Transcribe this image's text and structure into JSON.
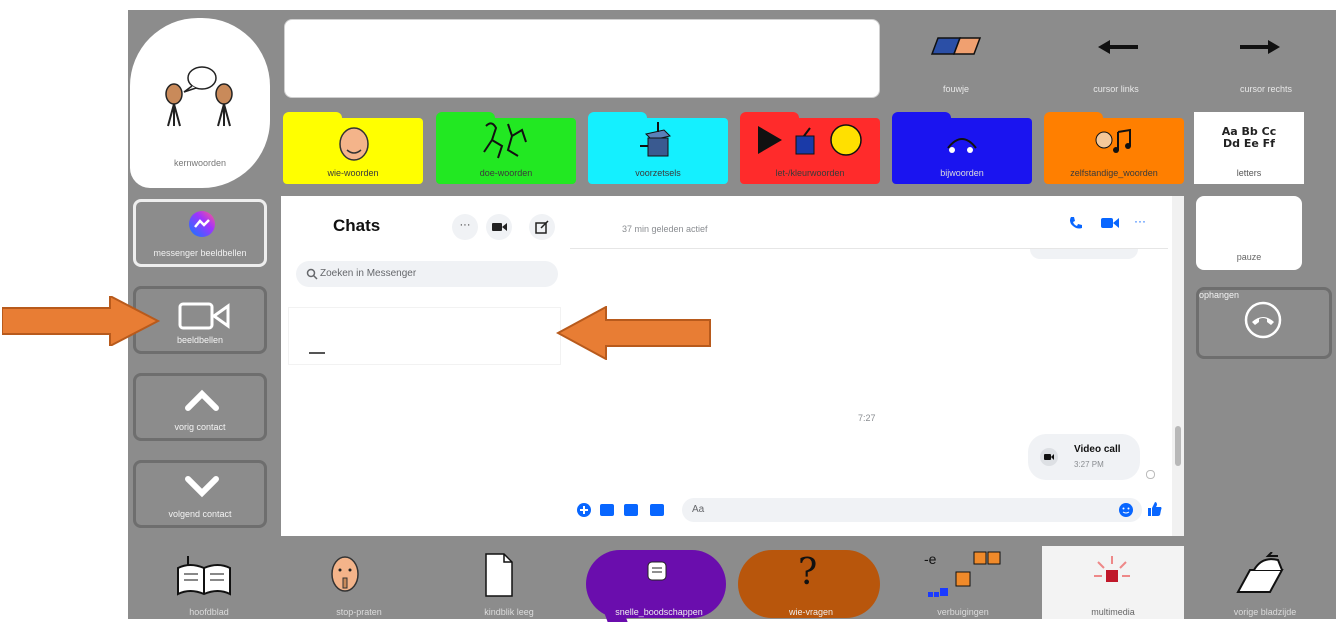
{
  "app": {
    "bubble_label": "kernwoorden",
    "message_box_value": ""
  },
  "top_tools": [
    {
      "label": "fouwje"
    },
    {
      "label": "cursor links"
    },
    {
      "label": "cursor rechts"
    }
  ],
  "folders": [
    {
      "label": "wie-woorden",
      "color": "#ffff00"
    },
    {
      "label": "doe-woorden",
      "color": "#22e822"
    },
    {
      "label": "voorzetsels",
      "color": "#14f0ff"
    },
    {
      "label": "let-/kleurwoorden",
      "color": "#ff2b2b"
    },
    {
      "label": "bijwoorden",
      "color": "#1a14f0"
    },
    {
      "label": "zelfstandige_woorden",
      "color": "#ff7f00"
    }
  ],
  "letters": {
    "big_line1": "Aa Bb Cc",
    "big_line2": "Dd Ee Ff",
    "label": "letters"
  },
  "left_buttons": [
    {
      "label": "messenger beeldbellen"
    },
    {
      "label": "beeldbellen"
    },
    {
      "label": "vorig contact"
    },
    {
      "label": "volgend contact"
    }
  ],
  "right_buttons": [
    {
      "label": "pauze"
    },
    {
      "label": "ophangen"
    }
  ],
  "messenger": {
    "title": "Chats",
    "search_placeholder": "Zoeken in Messenger",
    "active_status": "37 min geleden actief",
    "time_divider": "7:27",
    "call_title": "Video call",
    "call_time": "3:27 PM",
    "composer_placeholder": "Aa"
  },
  "bottom_bar": [
    {
      "label": "hoofdblad"
    },
    {
      "label": "stop-praten"
    },
    {
      "label": "kindblik leeg"
    },
    {
      "label": "snelle_boodschappen",
      "color": "#6a0dad"
    },
    {
      "label": "wie-vragen",
      "color": "#b8560c"
    },
    {
      "label": "verbuigingen"
    },
    {
      "label": "multimedia"
    },
    {
      "label": "vorige bladzijde"
    }
  ],
  "colors": {
    "annotation_arrow": "#e87d34",
    "messenger_blue": "#0866ff"
  }
}
